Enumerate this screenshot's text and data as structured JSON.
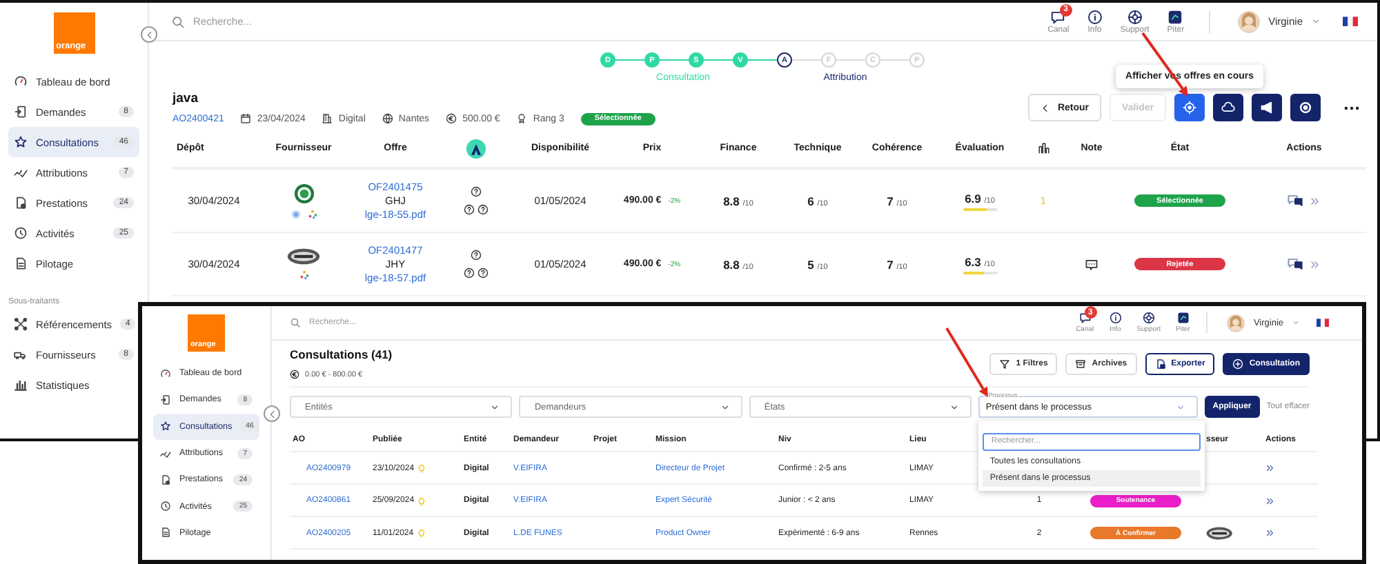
{
  "back": {
    "logo": "orange",
    "nav": [
      {
        "label": "Tableau de bord",
        "selected": false
      },
      {
        "label": "Demandes",
        "count": "8",
        "selected": false
      },
      {
        "label": "Consultations",
        "count": "46",
        "selected": true
      },
      {
        "label": "Attributions",
        "count": "7",
        "selected": false
      },
      {
        "label": "Prestations",
        "count": "24",
        "selected": false
      },
      {
        "label": "Activités",
        "count": "25",
        "selected": false
      },
      {
        "label": "Pilotage",
        "selected": false
      }
    ],
    "subcontractors": {
      "title": "Sous-traitants",
      "items": [
        {
          "label": "Référencements",
          "count": "4",
          "selected": false
        },
        {
          "label": "Fournisseurs",
          "count": "8",
          "selected": false
        },
        {
          "label": "Statistiques",
          "selected": false
        }
      ]
    },
    "search": {
      "placeholder": "Recherche..."
    },
    "tools": [
      {
        "label": "Canal",
        "badge": "3"
      },
      {
        "label": "Info"
      },
      {
        "label": "Support"
      },
      {
        "label": "Piter"
      }
    ],
    "user": "Virginie",
    "steps": [
      {
        "letter": "D",
        "completed": true,
        "current": false
      },
      {
        "letter": "P",
        "completed": true,
        "current": false
      },
      {
        "letter": "S",
        "completed": true,
        "current": false
      },
      {
        "letter": "V",
        "completed": true,
        "current": false
      },
      {
        "letter": "A",
        "completed": false,
        "current": true
      },
      {
        "letter": "F",
        "completed": false,
        "current": false
      },
      {
        "letter": "C",
        "completed": false,
        "current": false
      },
      {
        "letter": "P",
        "completed": false,
        "current": false
      }
    ],
    "step_labels": [
      {
        "text": "Consultation",
        "completed": true
      },
      {
        "text": "Attribution",
        "completed": false
      }
    ],
    "title": "java",
    "meta": {
      "ao": "AO2400421",
      "date": "23/04/2024",
      "entity": "Digital",
      "city": "Nantes",
      "amount": "500.00 €",
      "rank": "Rang 3",
      "status": {
        "label": "Sélectionnée",
        "color": "#1fa34a"
      }
    },
    "tooltip": "Afficher vos offres en cours",
    "actions": [
      {
        "kind": "back",
        "label": "Retour",
        "disabled": false,
        "selected": false
      },
      {
        "kind": "validate",
        "label": "Valider",
        "disabled": true,
        "selected": false
      },
      {
        "kind": "target",
        "disabled": false,
        "selected": true
      },
      {
        "kind": "cloud",
        "disabled": false,
        "selected": false
      },
      {
        "kind": "megaphone",
        "disabled": false,
        "selected": false
      },
      {
        "kind": "ring",
        "disabled": false,
        "selected": false
      },
      {
        "kind": "more",
        "disabled": false,
        "selected": false
      }
    ],
    "columns": [
      {
        "kind": "text",
        "label": "Dépôt"
      },
      {
        "kind": "text",
        "label": "Fournisseur"
      },
      {
        "kind": "text",
        "label": "Offre"
      },
      {
        "kind": "logo"
      },
      {
        "kind": "text",
        "label": "Disponibilité"
      },
      {
        "kind": "text",
        "label": "Prix"
      },
      {
        "kind": "text",
        "label": "Finance"
      },
      {
        "kind": "text",
        "label": "Technique"
      },
      {
        "kind": "text",
        "label": "Cohérence"
      },
      {
        "kind": "text",
        "label": "Évaluation"
      },
      {
        "kind": "ranking"
      },
      {
        "kind": "text",
        "label": "Note"
      },
      {
        "kind": "text",
        "label": "État"
      },
      {
        "kind": "text",
        "label": "Actions"
      }
    ],
    "rows": [
      {
        "deposit": "30/04/2024",
        "supplier": {
          "kind": "round",
          "marks": [
            {
              "kind": "disc"
            },
            {
              "kind": "dots"
            }
          ]
        },
        "offer": "OF2401475",
        "code": "GHJ",
        "file": "lge-18-55.pdf",
        "availability": "01/05/2024",
        "price": "490.00 €",
        "delta": "-2%",
        "scores": [
          {
            "value": "8.8",
            "max": "/10"
          },
          {
            "value": "6",
            "max": "/10"
          },
          {
            "value": "7",
            "max": "/10"
          }
        ],
        "evaluation": {
          "value": "6.9",
          "max": "/10",
          "level": 0.69
        },
        "count": "1",
        "note": false,
        "state": {
          "label": "Sélectionnée",
          "color": "#1fa34a"
        }
      },
      {
        "deposit": "30/04/2024",
        "supplier": {
          "kind": "oval",
          "marks": [
            {
              "kind": "dots"
            }
          ]
        },
        "offer": "OF2401477",
        "code": "JHY",
        "file": "lge-18-57.pdf",
        "availability": "01/05/2024",
        "price": "490.00 €",
        "delta": "-2%",
        "scores": [
          {
            "value": "8.8",
            "max": "/10"
          },
          {
            "value": "5",
            "max": "/10"
          },
          {
            "value": "7",
            "max": "/10"
          }
        ],
        "evaluation": {
          "value": "6.3",
          "max": "/10",
          "level": 0.63
        },
        "note": true,
        "state": {
          "label": "Rejetée",
          "color": "#dc3545"
        }
      }
    ]
  },
  "front": {
    "logo": "orange",
    "nav": [
      {
        "label": "Tableau de bord",
        "selected": false
      },
      {
        "label": "Demandes",
        "count": "8",
        "selected": false
      },
      {
        "label": "Consultations",
        "count": "46",
        "selected": true
      },
      {
        "label": "Attributions",
        "count": "7",
        "selected": false
      },
      {
        "label": "Prestations",
        "count": "24",
        "selected": false
      },
      {
        "label": "Activités",
        "count": "25",
        "selected": false
      },
      {
        "label": "Pilotage",
        "selected": false
      }
    ],
    "search": {
      "placeholder": "Recherche..."
    },
    "tools": [
      {
        "label": "Canal",
        "badge": "3"
      },
      {
        "label": "Info"
      },
      {
        "label": "Support"
      },
      {
        "label": "Piter"
      }
    ],
    "user": "Virginie",
    "title": "Consultations (41)",
    "range": "0.00 € - 800.00 €",
    "buttons": [
      {
        "kind": "filter",
        "label": "1 Filtres"
      },
      {
        "kind": "archive",
        "label": "Archives"
      },
      {
        "kind": "export",
        "label": "Exporter"
      },
      {
        "kind": "create",
        "label": "Consultation"
      }
    ],
    "filters": [
      {
        "kind": "placeholder",
        "placeholder": "Entités",
        "expanded": false
      },
      {
        "kind": "placeholder",
        "placeholder": "Demandeurs",
        "expanded": false
      },
      {
        "kind": "placeholder",
        "placeholder": "États",
        "expanded": false
      },
      {
        "kind": "value",
        "label": "Processus",
        "value": "Présent dans le processus",
        "expanded": true,
        "search": {
          "placeholder": "Rechercher..."
        },
        "options": [
          {
            "label": "Toutes les consultations",
            "selected": false
          },
          {
            "label": "Présent dans le processus",
            "selected": true
          }
        ]
      }
    ],
    "apply": "Appliquer",
    "clear": "Tout effacer",
    "columns": [
      "AO",
      "Publiée",
      "Entité",
      "Demandeur",
      "Projet",
      "Mission",
      "Niv",
      "Lieu",
      "sseur",
      "Actions"
    ],
    "rows": [
      {
        "ao": "AO2400979",
        "date": "23/10/2024",
        "entity": "Digital",
        "requester": "V.EIFIRA",
        "mission": "Directeur de Projet",
        "level": "Confirmé : 2-5 ans",
        "place": "LIMAY",
        "supplier_logo": false
      },
      {
        "ao": "AO2400861",
        "date": "25/09/2024",
        "entity": "Digital",
        "requester": "V.EIFIRA",
        "mission": "Expert Sécurité",
        "level": "Junior : < 2 ans",
        "place": "LIMAY",
        "count": "1",
        "state": {
          "label": "Soutenance",
          "color": "#e91ec8"
        },
        "supplier_logo": false
      },
      {
        "ao": "AO2400205",
        "date": "11/01/2024",
        "entity": "Digital",
        "requester": "L.DE FUNES",
        "mission": "Product Owner",
        "level": "Expérimenté : 6-9 ans",
        "place": "Rennes",
        "count": "2",
        "state": {
          "label": "À Confirmer",
          "color": "#e8782a"
        },
        "supplier_logo": true
      }
    ]
  }
}
